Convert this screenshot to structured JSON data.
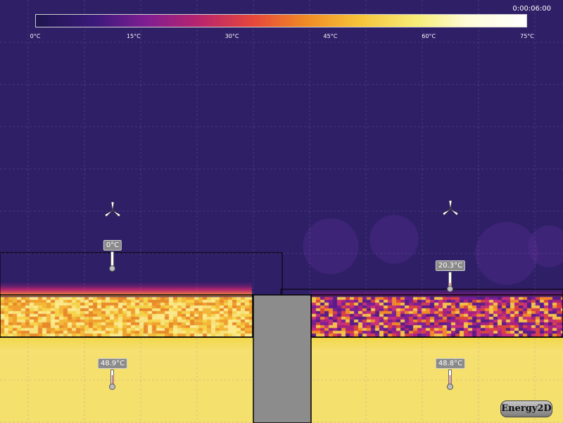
{
  "app": {
    "timer": "0:00:06:00",
    "logo": "Energy2D"
  },
  "colorbar": {
    "ticks": [
      {
        "label": "0°C",
        "value": 0
      },
      {
        "label": "15°C",
        "value": 15
      },
      {
        "label": "30°C",
        "value": 30
      },
      {
        "label": "45°C",
        "value": 45
      },
      {
        "label": "60°C",
        "value": 60
      },
      {
        "label": "75°C",
        "value": 75
      }
    ],
    "min": 0,
    "max": 75
  },
  "thermometers": {
    "top_left": {
      "label": "0°C",
      "value": 0
    },
    "top_right": {
      "label": "20.3°C",
      "value": 20.3
    },
    "bottom_left": {
      "label": "48.9°C",
      "value": 48.9
    },
    "bottom_right": {
      "label": "48.8°C",
      "value": 48.8
    }
  },
  "colors": {
    "background": "#2e1f66",
    "solid_divider": "#8c8c8c",
    "hot_layer": "#f4dc5a",
    "grid": "#6a5aa0"
  },
  "icons": {
    "fan": "fan-icon",
    "thermometer": "thermometer-icon"
  }
}
